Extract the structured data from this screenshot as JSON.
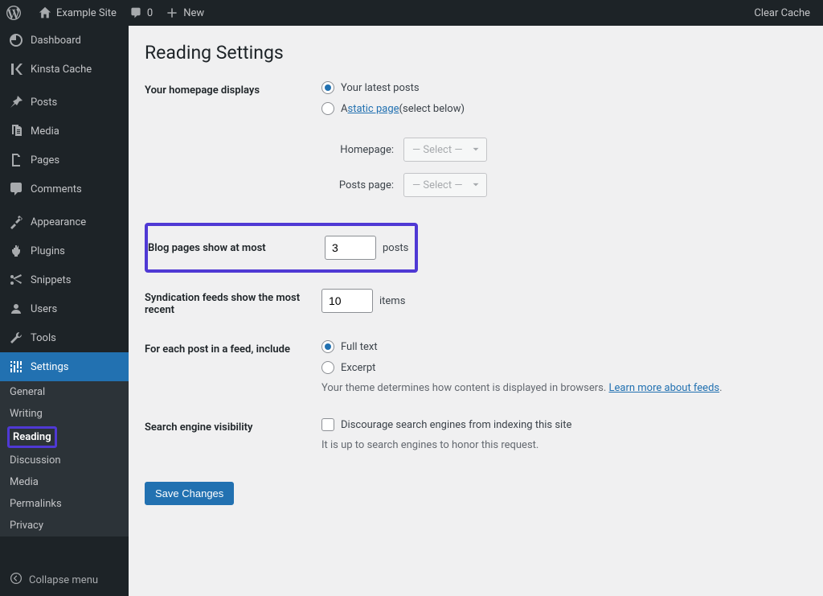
{
  "adminbar": {
    "site_name": "Example Site",
    "comments_count": "0",
    "new_label": "New",
    "clear_cache": "Clear Cache"
  },
  "sidebar": {
    "dashboard": "Dashboard",
    "kinsta": "Kinsta Cache",
    "posts": "Posts",
    "media": "Media",
    "pages": "Pages",
    "comments": "Comments",
    "appearance": "Appearance",
    "plugins": "Plugins",
    "snippets": "Snippets",
    "users": "Users",
    "tools": "Tools",
    "settings": "Settings",
    "submenu": {
      "general": "General",
      "writing": "Writing",
      "reading": "Reading",
      "discussion": "Discussion",
      "media": "Media",
      "permalinks": "Permalinks",
      "privacy": "Privacy"
    },
    "collapse": "Collapse menu"
  },
  "page": {
    "title": "Reading Settings",
    "homepage_displays": {
      "label": "Your homepage displays",
      "opt_latest": "Your latest posts",
      "opt_static_prefix": "A ",
      "opt_static_link": "static page",
      "opt_static_suffix": " (select below)",
      "homepage_label": "Homepage:",
      "posts_page_label": "Posts page:",
      "select_placeholder": "— Select —"
    },
    "blog_pages": {
      "label": "Blog pages show at most",
      "value": "3",
      "suffix": "posts"
    },
    "syndication": {
      "label": "Syndication feeds show the most recent",
      "value": "10",
      "suffix": "items"
    },
    "feed_include": {
      "label": "For each post in a feed, include",
      "full_text": "Full text",
      "excerpt": "Excerpt",
      "desc_prefix": "Your theme determines how content is displayed in browsers. ",
      "desc_link": "Learn more about feeds",
      "desc_suffix": "."
    },
    "seo": {
      "label": "Search engine visibility",
      "checkbox_label": "Discourage search engines from indexing this site",
      "desc": "It is up to search engines to honor this request."
    },
    "save": "Save Changes"
  }
}
